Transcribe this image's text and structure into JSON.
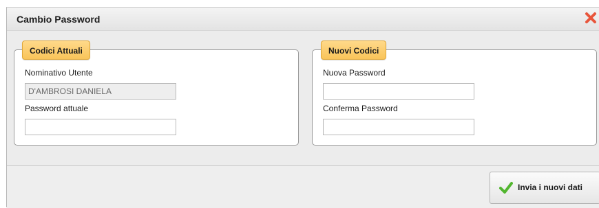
{
  "dialog": {
    "title": "Cambio Password"
  },
  "current_codes": {
    "legend": "Codici Attuali",
    "username_label": "Nominativo Utente",
    "username_value": "D'AMBROSI DANIELA",
    "current_password_label": "Password attuale",
    "current_password_value": ""
  },
  "new_codes": {
    "legend": "Nuovi Codici",
    "new_password_label": "Nuova Password",
    "new_password_value": "",
    "confirm_password_label": "Conferma Password",
    "confirm_password_value": ""
  },
  "footer": {
    "submit_label": "Invia i nuovi dati"
  },
  "icons": {
    "close": "close-icon",
    "submit": "check-icon"
  },
  "colors": {
    "legend_bg": "#f9c459",
    "close": "#e8553b",
    "check": "#52b62f"
  }
}
